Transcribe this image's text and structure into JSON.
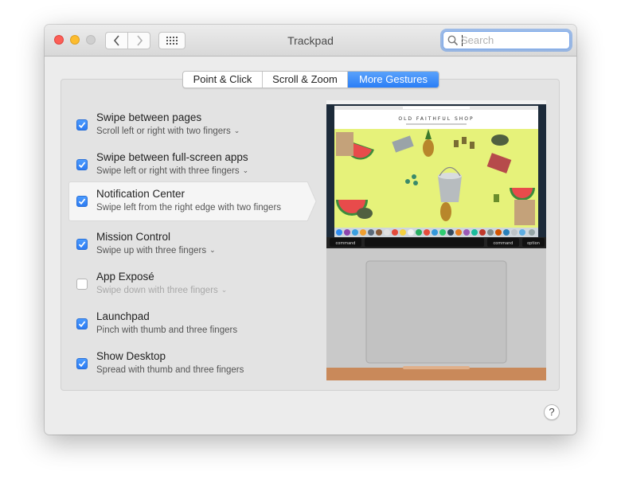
{
  "window": {
    "title": "Trackpad"
  },
  "search": {
    "placeholder": "Search",
    "value": ""
  },
  "tabs": [
    {
      "label": "Point & Click",
      "active": false
    },
    {
      "label": "Scroll & Zoom",
      "active": false
    },
    {
      "label": "More Gestures",
      "active": true
    }
  ],
  "gestures": [
    {
      "title": "Swipe between pages",
      "subtitle": "Scroll left or right with two fingers",
      "checked": true,
      "has_menu": true,
      "selected": false,
      "dim": false
    },
    {
      "title": "Swipe between full-screen apps",
      "subtitle": "Swipe left or right with three fingers",
      "checked": true,
      "has_menu": true,
      "selected": false,
      "dim": false
    },
    {
      "title": "Notification Center",
      "subtitle": "Swipe left from the right edge with two fingers",
      "checked": true,
      "has_menu": false,
      "selected": true,
      "dim": false
    },
    {
      "title": "Mission Control",
      "subtitle": "Swipe up with three fingers",
      "checked": true,
      "has_menu": true,
      "selected": false,
      "dim": false
    },
    {
      "title": "App Exposé",
      "subtitle": "Swipe down with three fingers",
      "checked": false,
      "has_menu": true,
      "selected": false,
      "dim": true
    },
    {
      "title": "Launchpad",
      "subtitle": "Pinch with thumb and three fingers",
      "checked": true,
      "has_menu": false,
      "selected": false,
      "dim": false
    },
    {
      "title": "Show Desktop",
      "subtitle": "Spread with thumb and three fingers",
      "checked": true,
      "has_menu": false,
      "selected": false,
      "dim": false
    }
  ],
  "preview": {
    "site_title": "OLD FAITHFUL SHOP",
    "keys": {
      "left_command": "command",
      "right_command": "command",
      "option": "option"
    }
  },
  "help": {
    "label": "?"
  },
  "colors": {
    "accent": "#2c7bf2",
    "close": "#fc5f57",
    "minimize": "#fdbc2e",
    "panel": "#e3e3e3",
    "preview_bg": "#e6f27a"
  }
}
